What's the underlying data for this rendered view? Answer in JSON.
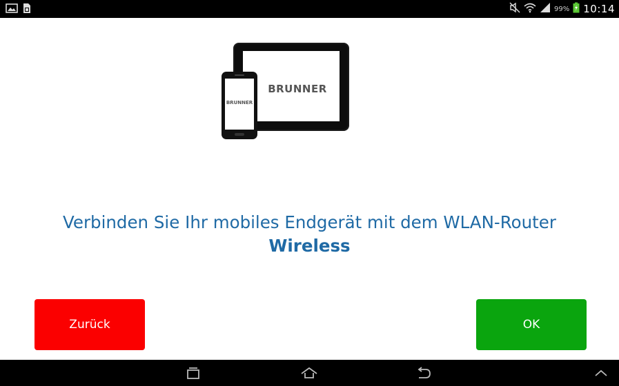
{
  "status_bar": {
    "battery_percent": "99%",
    "time": "10:14",
    "icons": [
      "image-icon",
      "sim-icon",
      "mute-icon",
      "wifi-icon",
      "signal-icon",
      "battery-charging-icon"
    ]
  },
  "illustration": {
    "tablet_brand": "BRUNNER",
    "phone_brand": "BRUNNER"
  },
  "message": {
    "text": "Verbinden Sie Ihr mobiles Endgerät mit dem WLAN-Router ",
    "network_name": "Wireless"
  },
  "buttons": {
    "back_label": "Zurück",
    "back_color": "#fb0000",
    "ok_label": "OK",
    "ok_color": "#0aa50e"
  },
  "accent_color": "#1f6aa5",
  "nav_bar": {
    "icons": [
      "recent-apps-icon",
      "home-icon",
      "back-icon",
      "chevron-up-icon"
    ]
  }
}
